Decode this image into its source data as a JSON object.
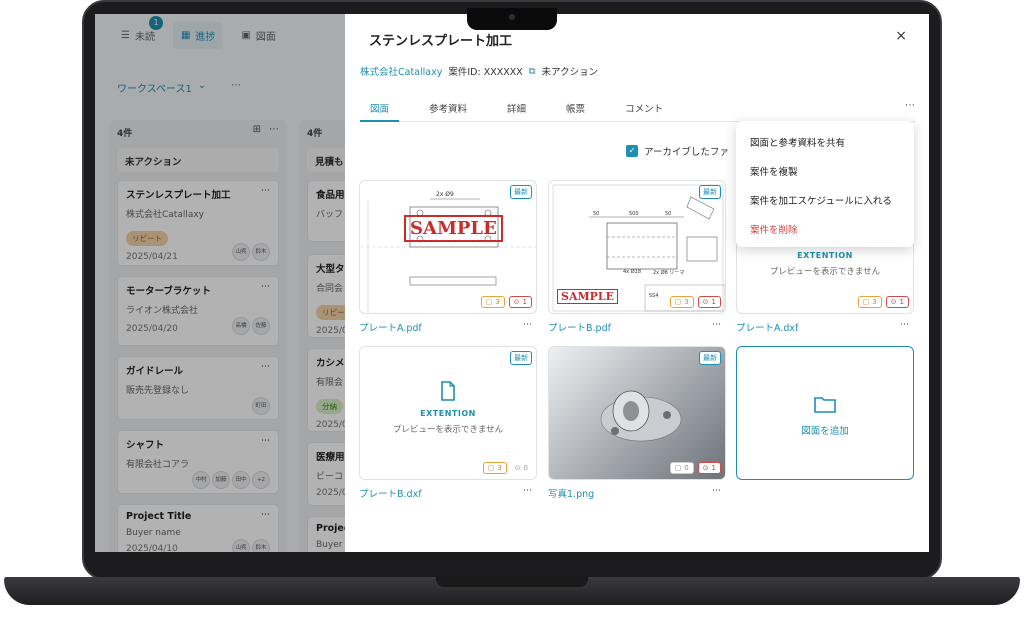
{
  "nav": {
    "unread": {
      "label": "未読",
      "badge": "1"
    },
    "progress": {
      "label": "進捗"
    },
    "drawings": {
      "label": "図面"
    }
  },
  "workspace": {
    "label": "ワークスペース1",
    "more": "⋯"
  },
  "board": {
    "col1": {
      "count": "4件",
      "title": "未アクション",
      "cards": [
        {
          "title": "ステンレスプレート加工",
          "company": "株式会社Catallaxy",
          "tag": "リピート",
          "date": "2025/04/21",
          "avatars": [
            "山呉",
            "鈴木"
          ]
        },
        {
          "title": "モーターブラケット",
          "company": "ライオン株式会社",
          "date": "2025/04/20",
          "avatars": [
            "高橋",
            "佐藤"
          ]
        },
        {
          "title": "ガイドレール",
          "company": "販売先登録なし",
          "avatars": [
            "町田"
          ]
        },
        {
          "title": "シャフト",
          "company": "有限会社コアラ",
          "avatars": [
            "中村",
            "加藤",
            "田中",
            "+2"
          ]
        },
        {
          "title": "Project Title",
          "company": "Buyer name",
          "date": "2025/04/10",
          "avatars": [
            "山呉",
            "鈴木"
          ]
        }
      ]
    },
    "col2": {
      "count": "4件",
      "title": "見積も",
      "cards": [
        {
          "title": "食品用",
          "company": "バッフ"
        },
        {
          "title": "大型タ",
          "company": "合同会",
          "tag": "リピー",
          "date": "2025/0"
        },
        {
          "title": "カシメ",
          "company": "有限会",
          "tag": "分納",
          "date": "2025/0"
        },
        {
          "title": "医療用",
          "company": "ビーコ",
          "date": "2025/0"
        },
        {
          "title": "Projec",
          "company": "Buyer"
        }
      ]
    }
  },
  "panel": {
    "title": "ステンレスプレート加工",
    "close": "×",
    "company": "株式会社Catallaxy",
    "case_id": "案件ID: XXXXXX",
    "status": "未アクション",
    "tabs": [
      "図面",
      "参考資料",
      "詳細",
      "帳票",
      "コメント"
    ],
    "tabs_more": "⋯",
    "archive_label": "アーカイブしたファ",
    "files": [
      {
        "name": "プレートA.pdf",
        "badge": "最新",
        "comments": "3",
        "alerts": "1",
        "sample": "SAMPLE",
        "dim": "2x Ø9"
      },
      {
        "name": "プレートB.pdf",
        "badge": "最新",
        "comments": "3",
        "alerts": "1",
        "sample": "SAMPLE",
        "dims": [
          "50",
          "500",
          "50",
          "4x Ø18",
          "2x Ø8 リーマ",
          "SS4"
        ]
      },
      {
        "name": "プレートA.dxf",
        "ext": "EXTENTION",
        "noprev": "プレビューを表示できません",
        "comments": "3",
        "alerts": "1"
      },
      {
        "name": "プレートB.dxf",
        "badge": "最新",
        "ext": "EXTENTION",
        "noprev": "プレビューを表示できません",
        "comments": "3",
        "alerts": "0"
      },
      {
        "name": "写真1.png",
        "badge": "最新",
        "comments": "0",
        "alerts": "1"
      }
    ],
    "add_label": "図面を追加",
    "file_more": "⋯"
  },
  "menu": {
    "items": [
      "図面と参考資料を共有",
      "案件を複製",
      "案件を加工スケジュールに入れる",
      "案件を削除"
    ]
  },
  "colors": {
    "accent": "#1f8fb0",
    "danger": "#d63b3b",
    "warning": "#e7a33b"
  }
}
